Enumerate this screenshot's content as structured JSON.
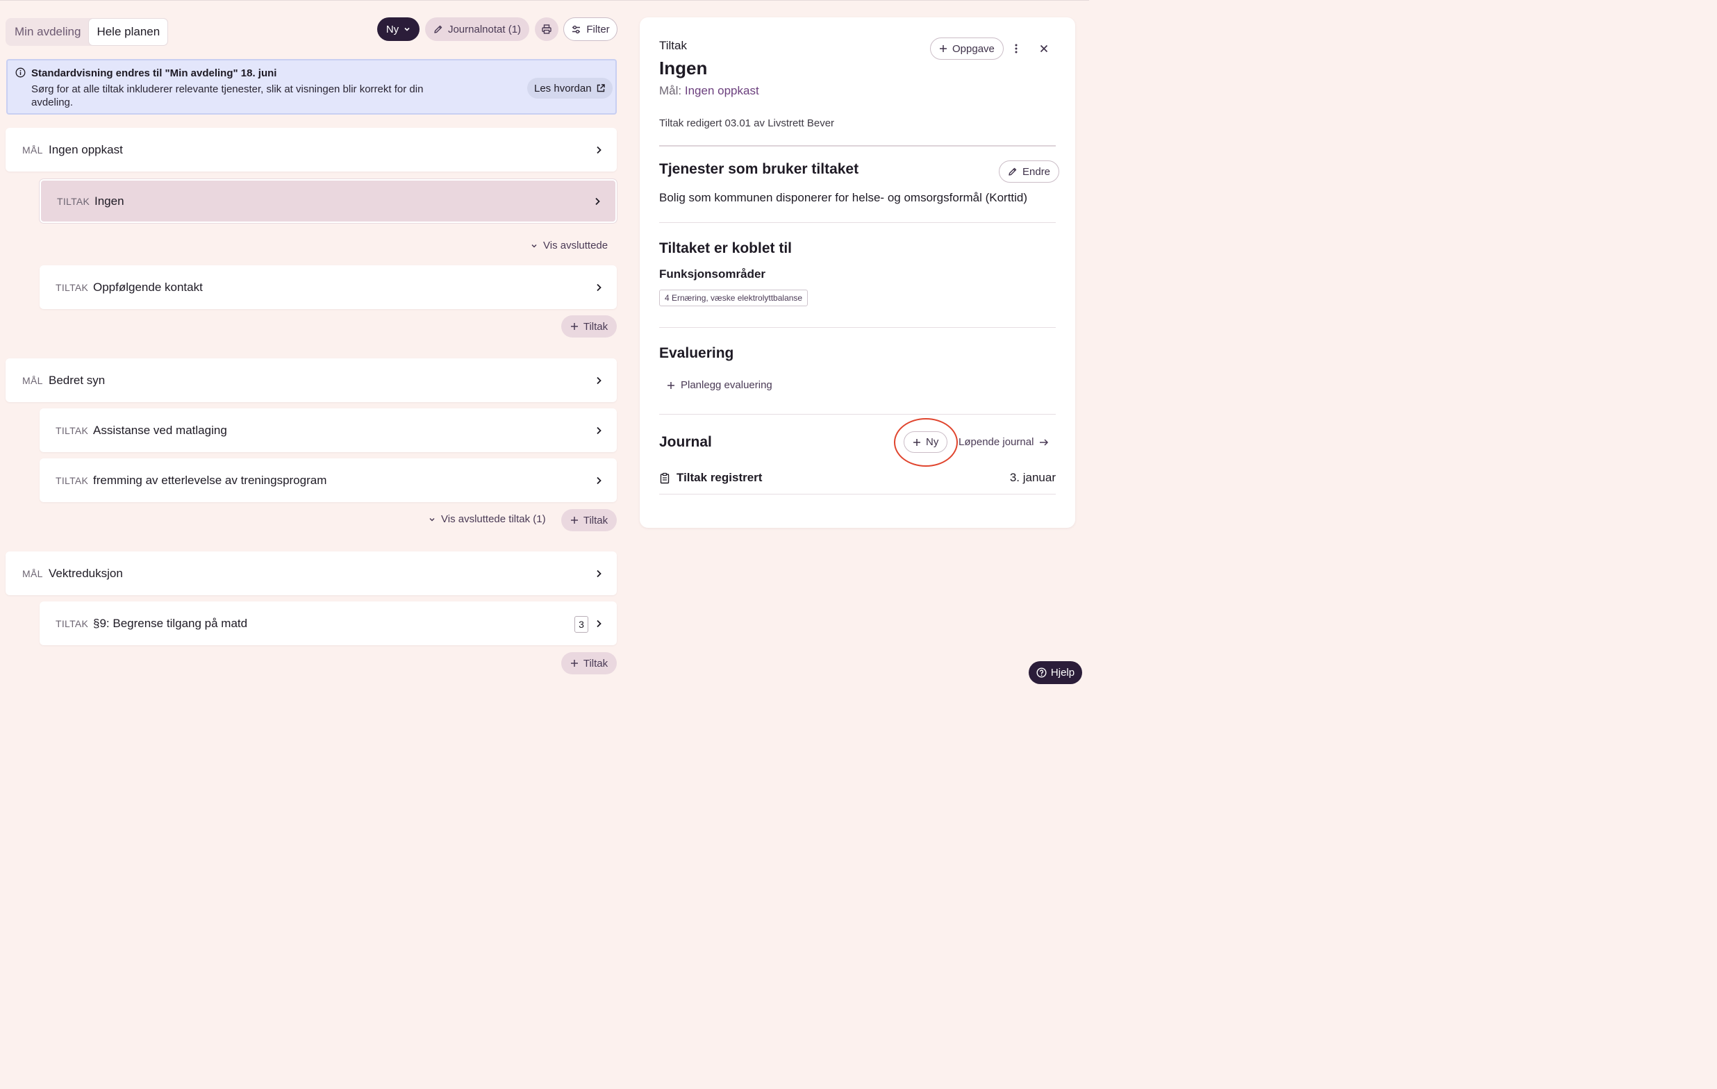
{
  "view_toggle": {
    "option_1": "Min avdeling",
    "option_2": "Hele planen"
  },
  "toolbar": {
    "new_label": "Ny",
    "journal_label": "Journalnotat (1)",
    "filter_label": "Filter"
  },
  "banner": {
    "title": "Standardvisning endres til \"Min avdeling\" 18. juni",
    "text": "Sørg for at alle tiltak inkluderer relevante tjenester, slik at visningen blir korrekt for din avdeling.",
    "link_label": "Les hvordan"
  },
  "labels": {
    "goal_kind": "MÅL",
    "action_kind": "TILTAK",
    "add_action": "Tiltak"
  },
  "goals": [
    {
      "title": "Ingen oppkast",
      "actions": [
        "Ingen",
        "Oppfølgende kontakt"
      ],
      "show_closed": "Vis avsluttede"
    },
    {
      "title": "Bedret syn",
      "actions": [
        "Assistanse ved matlaging",
        "fremming av etterlevelse av treningsprogram"
      ],
      "show_closed": "Vis avsluttede tiltak (1)"
    },
    {
      "title": "Vektreduksjon",
      "actions": [
        "§9: Begrense tilgang på matd"
      ],
      "action_badge": "3"
    }
  ],
  "panel": {
    "label": "Tiltak",
    "title": "Ingen",
    "goal_prefix": "Mål:",
    "goal_link": "Ingen oppkast",
    "task_button": "Oppgave",
    "edited": "Tiltak redigert 03.01 av Livstrett Bever",
    "services_heading": "Tjenester som bruker tiltaket",
    "edit_button": "Endre",
    "services_text": "Bolig som kommunen disponerer for helse- og omsorgsformål (Korttid)",
    "linked_heading": "Tiltaket er koblet til",
    "function_areas_heading": "Funksjonsområder",
    "function_area_tag": "4 Ernæring, væske elektrolyttbalanse",
    "evaluation_heading": "Evaluering",
    "plan_evaluation": "Planlegg evaluering",
    "journal_heading": "Journal",
    "journal_new": "Ny",
    "running_journal": "Løpende journal",
    "journal_entry": {
      "title": "Tiltak registrert",
      "date": "3. januar"
    }
  },
  "help_label": "Hjelp",
  "colors": {
    "background": "#fcf1ee",
    "accent_dark": "#2b1d39",
    "accent_soft": "#ead8df",
    "info_bg": "#e3e6fb",
    "highlight_circle": "#e0452e"
  }
}
